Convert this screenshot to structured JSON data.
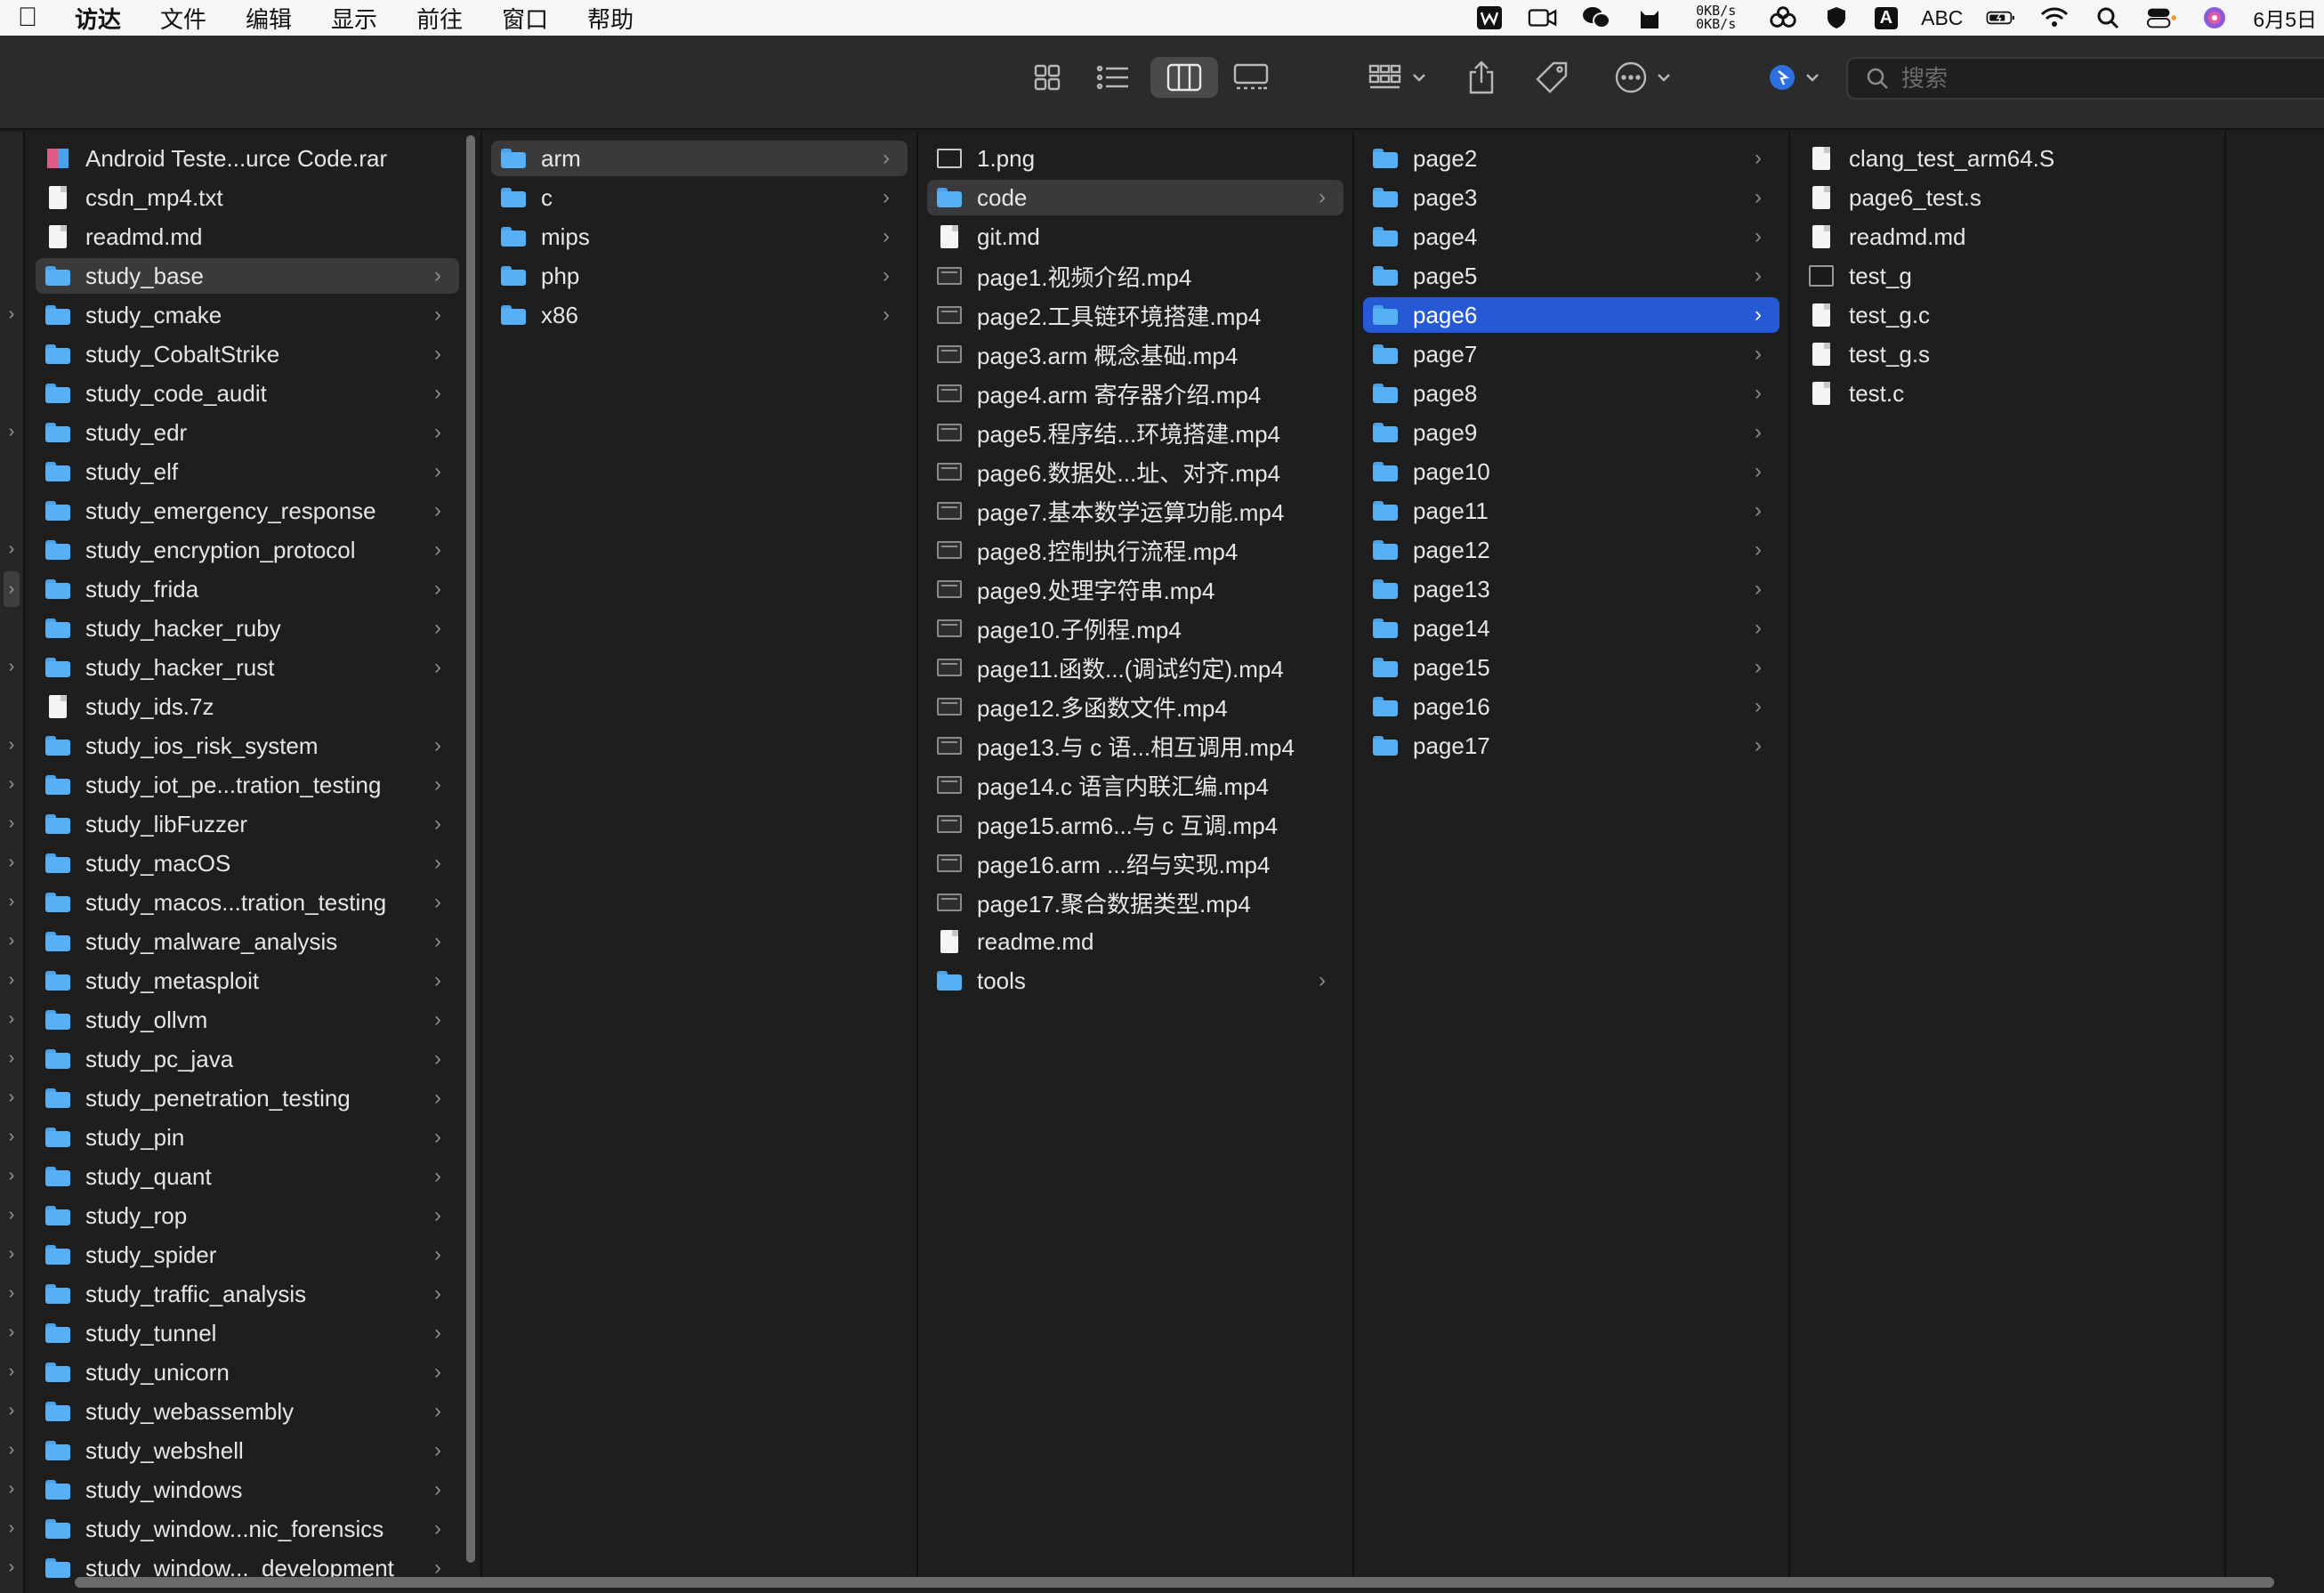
{
  "menubar": {
    "apple_icon": "apple-icon",
    "app_name": "访达",
    "menus": [
      "文件",
      "编辑",
      "显示",
      "前往",
      "窗口",
      "帮助"
    ],
    "status": {
      "net_up": "0KB/s",
      "net_down": "0KB/s",
      "input_badge": "A",
      "input_method": "ABC",
      "date": "6月5日"
    }
  },
  "toolbar": {
    "search_placeholder": "搜索"
  },
  "columns": [
    {
      "items": [
        {
          "label": "Android Teste...urce Code.rar",
          "icon": "archive",
          "folder": false
        },
        {
          "label": "csdn_mp4.txt",
          "icon": "doc",
          "folder": false
        },
        {
          "label": "readmd.md",
          "icon": "doc",
          "folder": false
        },
        {
          "label": "study_base",
          "icon": "folder",
          "folder": true,
          "state": "dim"
        },
        {
          "label": "study_cmake",
          "icon": "folder",
          "folder": true
        },
        {
          "label": "study_CobaltStrike",
          "icon": "folder",
          "folder": true
        },
        {
          "label": "study_code_audit",
          "icon": "folder",
          "folder": true
        },
        {
          "label": "study_edr",
          "icon": "folder",
          "folder": true
        },
        {
          "label": "study_elf",
          "icon": "folder",
          "folder": true
        },
        {
          "label": "study_emergency_response",
          "icon": "folder",
          "folder": true
        },
        {
          "label": "study_encryption_protocol",
          "icon": "folder",
          "folder": true
        },
        {
          "label": "study_frida",
          "icon": "folder",
          "folder": true
        },
        {
          "label": "study_hacker_ruby",
          "icon": "folder",
          "folder": true
        },
        {
          "label": "study_hacker_rust",
          "icon": "folder",
          "folder": true
        },
        {
          "label": "study_ids.7z",
          "icon": "doc",
          "folder": false
        },
        {
          "label": "study_ios_risk_system",
          "icon": "folder",
          "folder": true
        },
        {
          "label": "study_iot_pe...tration_testing",
          "icon": "folder",
          "folder": true
        },
        {
          "label": "study_libFuzzer",
          "icon": "folder",
          "folder": true
        },
        {
          "label": "study_macOS",
          "icon": "folder",
          "folder": true
        },
        {
          "label": "study_macos...tration_testing",
          "icon": "folder",
          "folder": true
        },
        {
          "label": "study_malware_analysis",
          "icon": "folder",
          "folder": true
        },
        {
          "label": "study_metasploit",
          "icon": "folder",
          "folder": true
        },
        {
          "label": "study_ollvm",
          "icon": "folder",
          "folder": true
        },
        {
          "label": "study_pc_java",
          "icon": "folder",
          "folder": true
        },
        {
          "label": "study_penetration_testing",
          "icon": "folder",
          "folder": true
        },
        {
          "label": "study_pin",
          "icon": "folder",
          "folder": true
        },
        {
          "label": "study_quant",
          "icon": "folder",
          "folder": true
        },
        {
          "label": "study_rop",
          "icon": "folder",
          "folder": true
        },
        {
          "label": "study_spider",
          "icon": "folder",
          "folder": true
        },
        {
          "label": "study_traffic_analysis",
          "icon": "folder",
          "folder": true
        },
        {
          "label": "study_tunnel",
          "icon": "folder",
          "folder": true
        },
        {
          "label": "study_unicorn",
          "icon": "folder",
          "folder": true
        },
        {
          "label": "study_webassembly",
          "icon": "folder",
          "folder": true
        },
        {
          "label": "study_webshell",
          "icon": "folder",
          "folder": true
        },
        {
          "label": "study_windows",
          "icon": "folder",
          "folder": true
        },
        {
          "label": "study_window...nic_forensics",
          "icon": "folder",
          "folder": true
        },
        {
          "label": "study_window..._development",
          "icon": "folder",
          "folder": true
        }
      ]
    },
    {
      "items": [
        {
          "label": "arm",
          "icon": "folder",
          "folder": true,
          "state": "dim"
        },
        {
          "label": "c",
          "icon": "folder",
          "folder": true
        },
        {
          "label": "mips",
          "icon": "folder",
          "folder": true
        },
        {
          "label": "php",
          "icon": "folder",
          "folder": true
        },
        {
          "label": "x86",
          "icon": "folder",
          "folder": true
        }
      ]
    },
    {
      "items": [
        {
          "label": "1.png",
          "icon": "image",
          "folder": false
        },
        {
          "label": "code",
          "icon": "folder",
          "folder": true,
          "state": "dim"
        },
        {
          "label": "git.md",
          "icon": "doc",
          "folder": false
        },
        {
          "label": "page1.视频介绍.mp4",
          "icon": "video",
          "folder": false
        },
        {
          "label": "page2.工具链环境搭建.mp4",
          "icon": "video",
          "folder": false
        },
        {
          "label": "page3.arm 概念基础.mp4",
          "icon": "video",
          "folder": false
        },
        {
          "label": "page4.arm 寄存器介绍.mp4",
          "icon": "video",
          "folder": false
        },
        {
          "label": "page5.程序结...环境搭建.mp4",
          "icon": "video",
          "folder": false
        },
        {
          "label": "page6.数据处...址、对齐.mp4",
          "icon": "video",
          "folder": false
        },
        {
          "label": "page7.基本数学运算功能.mp4",
          "icon": "video",
          "folder": false
        },
        {
          "label": "page8.控制执行流程.mp4",
          "icon": "video",
          "folder": false
        },
        {
          "label": "page9.处理字符串.mp4",
          "icon": "video",
          "folder": false
        },
        {
          "label": "page10.子例程.mp4",
          "icon": "video",
          "folder": false
        },
        {
          "label": "page11.函数...(调试约定).mp4",
          "icon": "video",
          "folder": false
        },
        {
          "label": "page12.多函数文件.mp4",
          "icon": "video",
          "folder": false
        },
        {
          "label": "page13.与 c 语...相互调用.mp4",
          "icon": "video",
          "folder": false
        },
        {
          "label": "page14.c 语言内联汇编.mp4",
          "icon": "video",
          "folder": false
        },
        {
          "label": "page15.arm6...与 c 互调.mp4",
          "icon": "video",
          "folder": false
        },
        {
          "label": "page16.arm ...绍与实现.mp4",
          "icon": "video",
          "folder": false
        },
        {
          "label": "page17.聚合数据类型.mp4",
          "icon": "video",
          "folder": false
        },
        {
          "label": "readme.md",
          "icon": "doc",
          "folder": false
        },
        {
          "label": "tools",
          "icon": "folder",
          "folder": true
        }
      ]
    },
    {
      "items": [
        {
          "label": "page2",
          "icon": "folder",
          "folder": true
        },
        {
          "label": "page3",
          "icon": "folder",
          "folder": true
        },
        {
          "label": "page4",
          "icon": "folder",
          "folder": true
        },
        {
          "label": "page5",
          "icon": "folder",
          "folder": true
        },
        {
          "label": "page6",
          "icon": "folder",
          "folder": true,
          "state": "sel"
        },
        {
          "label": "page7",
          "icon": "folder",
          "folder": true
        },
        {
          "label": "page8",
          "icon": "folder",
          "folder": true
        },
        {
          "label": "page9",
          "icon": "folder",
          "folder": true
        },
        {
          "label": "page10",
          "icon": "folder",
          "folder": true
        },
        {
          "label": "page11",
          "icon": "folder",
          "folder": true
        },
        {
          "label": "page12",
          "icon": "folder",
          "folder": true
        },
        {
          "label": "page13",
          "icon": "folder",
          "folder": true
        },
        {
          "label": "page14",
          "icon": "folder",
          "folder": true
        },
        {
          "label": "page15",
          "icon": "folder",
          "folder": true
        },
        {
          "label": "page16",
          "icon": "folder",
          "folder": true
        },
        {
          "label": "page17",
          "icon": "folder",
          "folder": true
        }
      ]
    },
    {
      "items": [
        {
          "label": "clang_test_arm64.S",
          "icon": "doc",
          "folder": false
        },
        {
          "label": "page6_test.s",
          "icon": "doc",
          "folder": false
        },
        {
          "label": "readmd.md",
          "icon": "doc",
          "folder": false
        },
        {
          "label": "test_g",
          "icon": "exec",
          "folder": false
        },
        {
          "label": "test_g.c",
          "icon": "doc",
          "folder": false
        },
        {
          "label": "test_g.s",
          "icon": "doc",
          "folder": false
        },
        {
          "label": "test.c",
          "icon": "doc",
          "folder": false
        }
      ]
    }
  ]
}
